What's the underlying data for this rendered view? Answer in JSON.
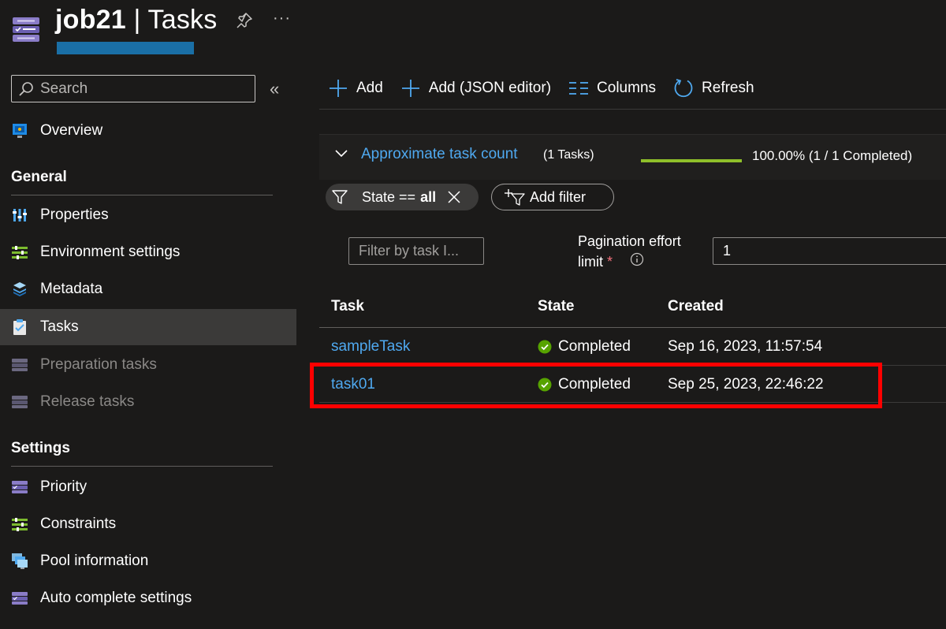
{
  "header": {
    "job_name": "job21",
    "separator": " | ",
    "page_name": "Tasks",
    "more_label": "···"
  },
  "sidebar": {
    "search_placeholder": "Search",
    "collapse_label": "«",
    "overview": {
      "label": "Overview",
      "icon": "overview-icon"
    },
    "sections": [
      {
        "title": "General",
        "items": [
          {
            "label": "Properties",
            "icon": "properties-icon",
            "state": "normal"
          },
          {
            "label": "Environment settings",
            "icon": "environment-settings-icon",
            "state": "normal"
          },
          {
            "label": "Metadata",
            "icon": "metadata-icon",
            "state": "normal"
          },
          {
            "label": "Tasks",
            "icon": "tasks-icon",
            "state": "active"
          },
          {
            "label": "Preparation tasks",
            "icon": "preparation-tasks-icon",
            "state": "disabled"
          },
          {
            "label": "Release tasks",
            "icon": "release-tasks-icon",
            "state": "disabled"
          }
        ]
      },
      {
        "title": "Settings",
        "items": [
          {
            "label": "Priority",
            "icon": "priority-icon",
            "state": "normal"
          },
          {
            "label": "Constraints",
            "icon": "constraints-icon",
            "state": "normal"
          },
          {
            "label": "Pool information",
            "icon": "pool-information-icon",
            "state": "normal"
          },
          {
            "label": "Auto complete settings",
            "icon": "auto-complete-settings-icon",
            "state": "normal"
          }
        ]
      }
    ]
  },
  "toolbar": {
    "add_label": "Add",
    "add_json_label": "Add (JSON editor)",
    "columns_label": "Columns",
    "refresh_label": "Refresh"
  },
  "task_count": {
    "title": "Approximate task count",
    "subtitle": "(1 Tasks)",
    "progress": 1.0,
    "progress_text": "100.00% (1 / 1 Completed)",
    "progress_color": "#8fbf2a"
  },
  "filters": {
    "state_prefix": "State == ",
    "state_value": "all",
    "add_filter_label": "Add filter",
    "task_filter_placeholder": "Filter by task I...",
    "pagination_label_line1": "Pagination effort",
    "pagination_label_line2": "limit",
    "required_marker": "*",
    "pagination_value": "1"
  },
  "table": {
    "columns": [
      "Task",
      "State",
      "Created"
    ],
    "rows": [
      {
        "task": "sampleTask",
        "state": "Completed",
        "created": "Sep 16, 2023, 11:57:54"
      },
      {
        "task": "task01",
        "state": "Completed",
        "created": "Sep 25, 2023, 22:46:22"
      }
    ]
  },
  "colors": {
    "accent_link": "#4fa9f0",
    "success": "#57a300",
    "highlight": "#ff0000"
  }
}
